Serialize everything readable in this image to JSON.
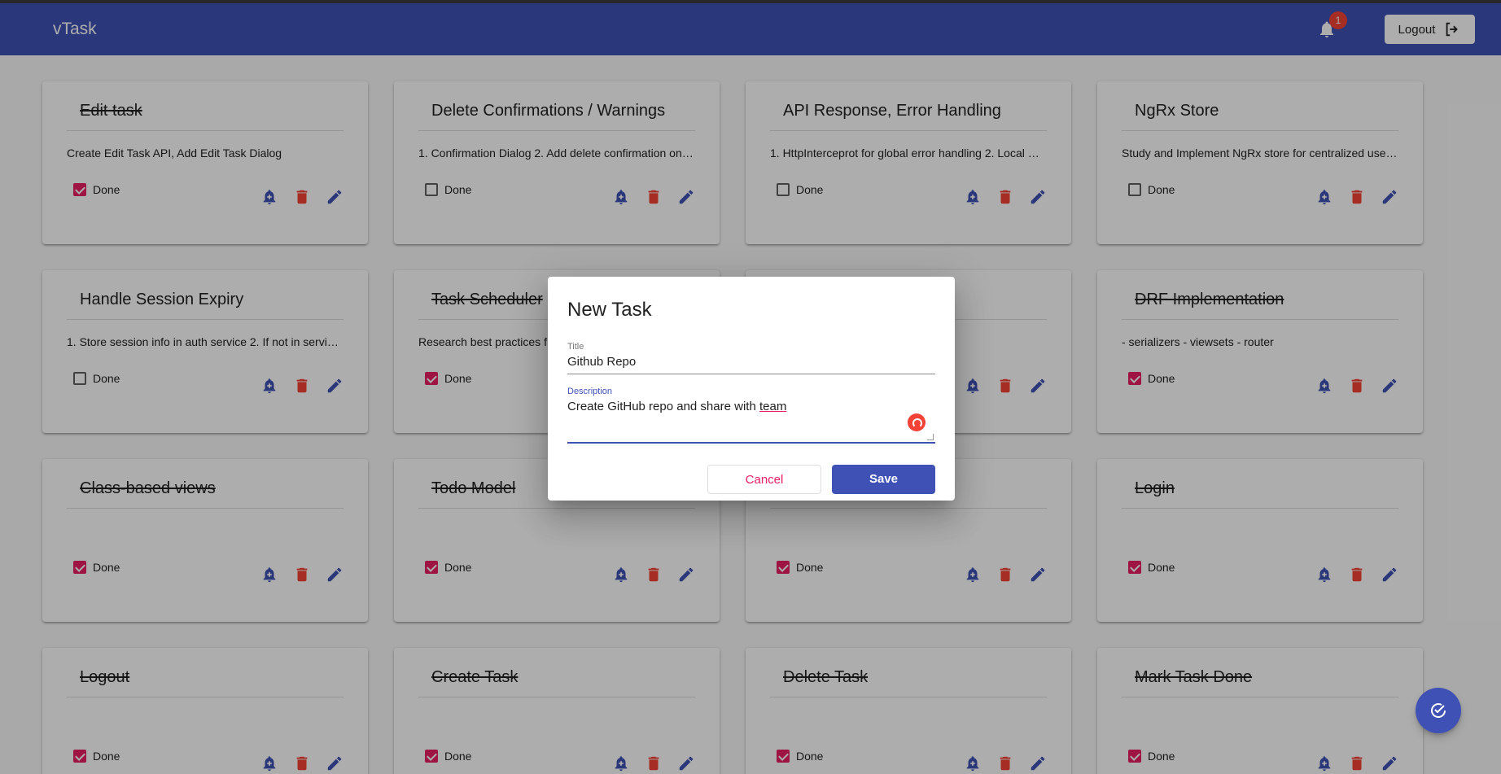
{
  "app": {
    "brand": "vTask"
  },
  "header": {
    "notification_count": "1",
    "logout_label": "Logout"
  },
  "colors": {
    "primary": "#3f51b5",
    "accent": "#e91e63",
    "warn": "#f44336"
  },
  "cards": [
    {
      "title": "Edit task",
      "description": "Create Edit Task API, Add Edit Task Dialog",
      "done": true,
      "done_label": "Done"
    },
    {
      "title": "Delete Confirmations / Warnings",
      "description": "1. Confirmation Dialog 2. Add delete confirmation on …",
      "done": false,
      "done_label": "Done"
    },
    {
      "title": "API Response, Error Handling",
      "description": "1. HttpInterceprot for global error handling 2. Local E…",
      "done": false,
      "done_label": "Done"
    },
    {
      "title": "NgRx Store",
      "description": "Study and Implement NgRx store for centralized user …",
      "done": false,
      "done_label": "Done"
    },
    {
      "title": "Handle Session Expiry",
      "description": "1. Store session info in auth service 2. If not in servic…",
      "done": false,
      "done_label": "Done"
    },
    {
      "title": "Task Scheduler",
      "description": "Research best practices f",
      "done": true,
      "done_label": "Done"
    },
    {
      "title": "",
      "description": "",
      "done": false,
      "done_label": ""
    },
    {
      "title": "DRF Implementation",
      "description": "- serializers - viewsets - router",
      "done": true,
      "done_label": "Done"
    },
    {
      "title": "Class-based views",
      "description": "",
      "done": true,
      "done_label": "Done"
    },
    {
      "title": "Todo Model",
      "description": "",
      "done": true,
      "done_label": "Done"
    },
    {
      "title": "",
      "description": "",
      "done": true,
      "done_label": "Done"
    },
    {
      "title": "Login",
      "description": "",
      "done": true,
      "done_label": "Done"
    },
    {
      "title": "Logout",
      "description": "",
      "done": true,
      "done_label": "Done"
    },
    {
      "title": "Create Task",
      "description": "",
      "done": true,
      "done_label": "Done"
    },
    {
      "title": "Delete Task",
      "description": "",
      "done": true,
      "done_label": "Done"
    },
    {
      "title": "Mark Task Done",
      "description": "",
      "done": true,
      "done_label": "Done"
    }
  ],
  "dialog": {
    "title": "New Task",
    "title_label": "Title",
    "title_value": "Github Repo",
    "description_label": "Description",
    "description_value_before": "Create GitHub repo and share with ",
    "description_value_misspelled": "team",
    "cancel_label": "Cancel",
    "save_label": "Save"
  },
  "icons": {
    "notification": "bell-icon",
    "logout": "logout-icon",
    "reminder": "add-alert-icon",
    "delete": "trash-icon",
    "edit": "pencil-icon",
    "fab": "add-task-icon"
  }
}
